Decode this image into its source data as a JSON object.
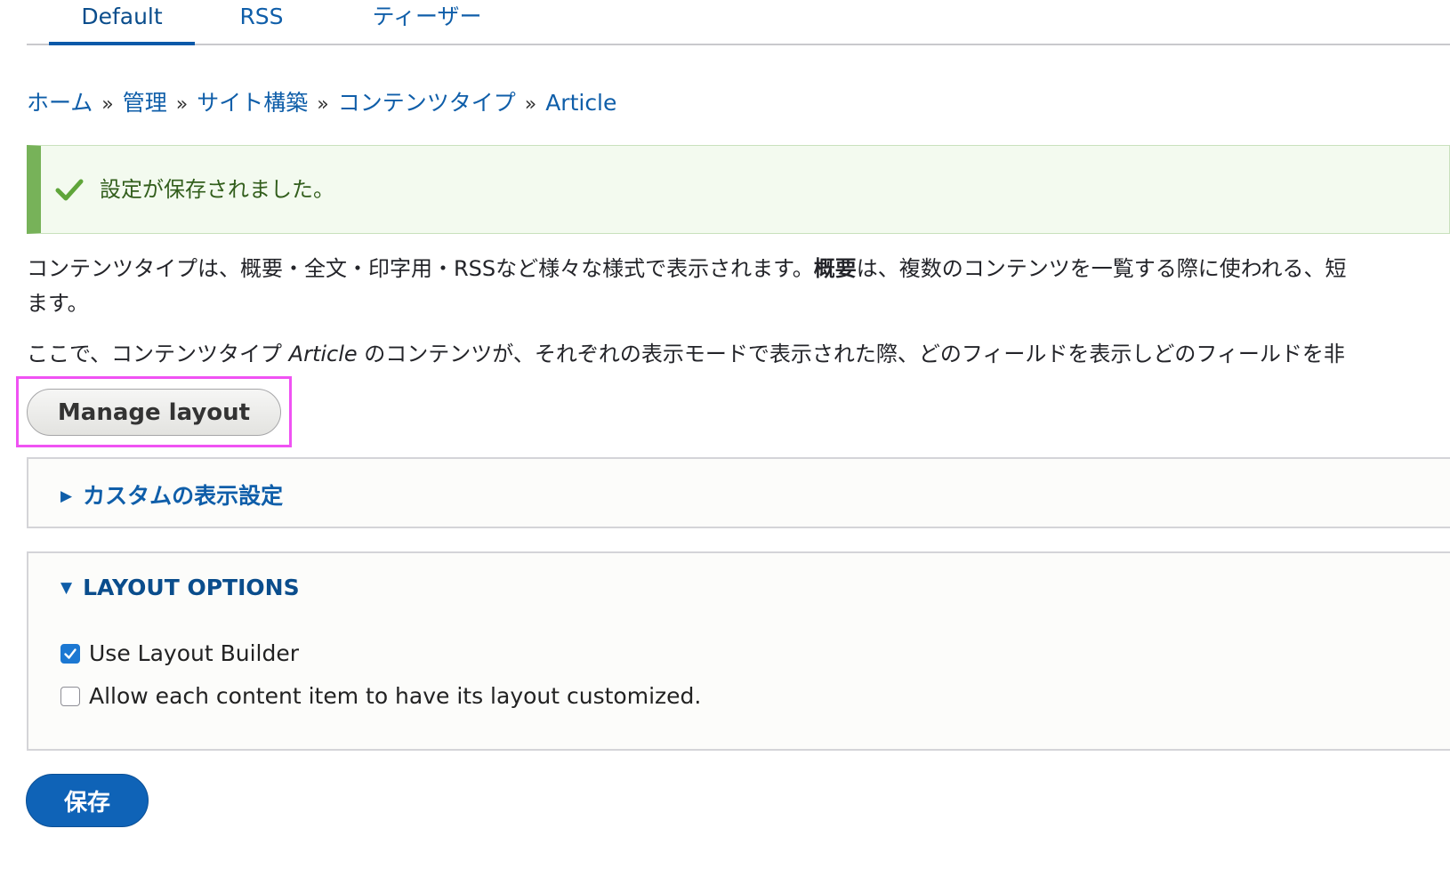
{
  "tabs": [
    {
      "label": "Default",
      "active": true
    },
    {
      "label": "RSS",
      "active": false
    },
    {
      "label": "ティーザー",
      "active": false
    }
  ],
  "breadcrumb": {
    "items": [
      "ホーム",
      "管理",
      "サイト構築",
      "コンテンツタイプ",
      "Article"
    ],
    "separator": "»"
  },
  "status": {
    "icon": "check-icon",
    "message": "設定が保存されました。",
    "accent_color": "#77b259"
  },
  "description": {
    "line1_part1": "コンテンツタイプは、概要・全文・印字用・RSSなど様々な様式で表示されます。",
    "line1_bold": "概要",
    "line1_part2": "は、複数のコンテンツを一覧する際に使われる、短",
    "line2": "ます。",
    "line3_part1": "ここで、コンテンツタイプ ",
    "line3_italic": "Article",
    "line3_part2": " のコンテンツが、それぞれの表示モードで表示された際、どのフィールドを表示しどのフィールドを非"
  },
  "manage_layout": {
    "label": "Manage layout"
  },
  "custom_display": {
    "label": "カスタムの表示設定",
    "expanded": false
  },
  "layout_options": {
    "label": "LAYOUT OPTIONS",
    "expanded": true,
    "use_layout_builder": {
      "label": "Use Layout Builder",
      "checked": true
    },
    "allow_custom": {
      "label": "Allow each content item to have its layout customized.",
      "checked": false
    }
  },
  "save": {
    "label": "保存",
    "color": "#0f63b7"
  }
}
